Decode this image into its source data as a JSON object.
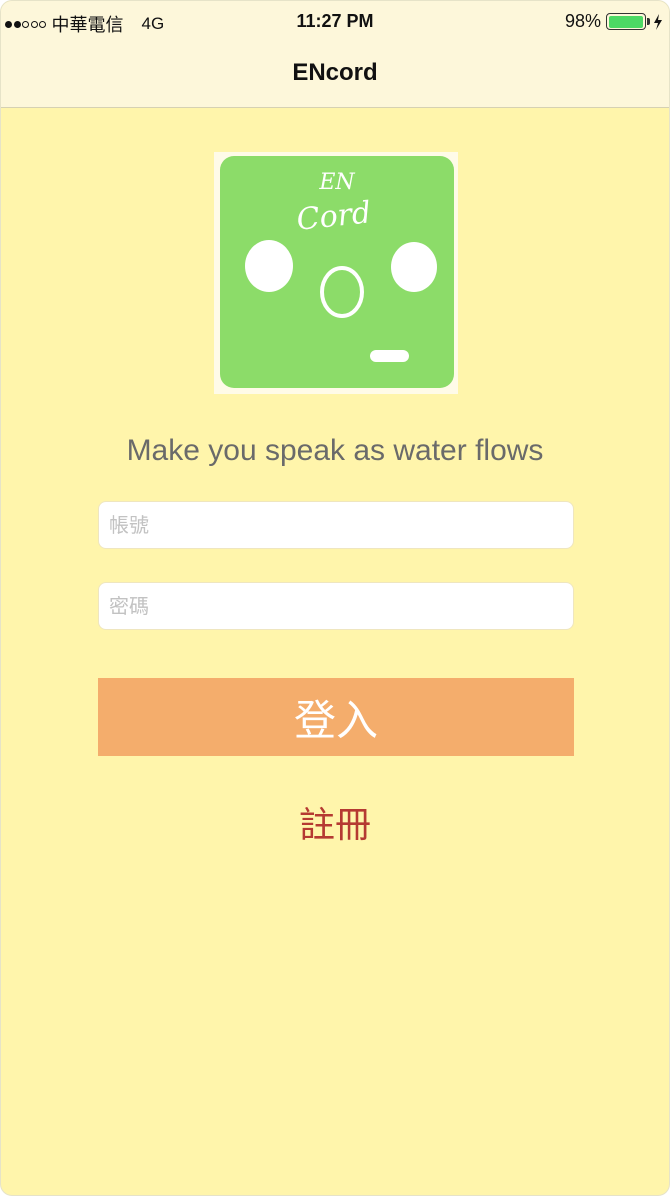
{
  "status_bar": {
    "signal_full": 2,
    "signal_total": 5,
    "carrier": "中華電信",
    "network": "4G",
    "time": "11:27 PM",
    "battery_percent": "98%",
    "battery_level": 0.98,
    "icons": [
      "signal-icon",
      "battery-icon",
      "charging-bolt-icon"
    ]
  },
  "nav": {
    "title": "ENcord"
  },
  "logo": {
    "line1": "EN",
    "line2": "Cord",
    "background_color": "#8cdc69"
  },
  "tagline": "Make you speak as water flows",
  "form": {
    "account_placeholder": "帳號",
    "password_placeholder": "密碼",
    "login_label": "登入",
    "register_label": "註冊"
  },
  "colors": {
    "background": "#fff5ab",
    "login_button": "#f4ad6c",
    "register_link": "#b53a32",
    "battery": "#4cd964"
  }
}
